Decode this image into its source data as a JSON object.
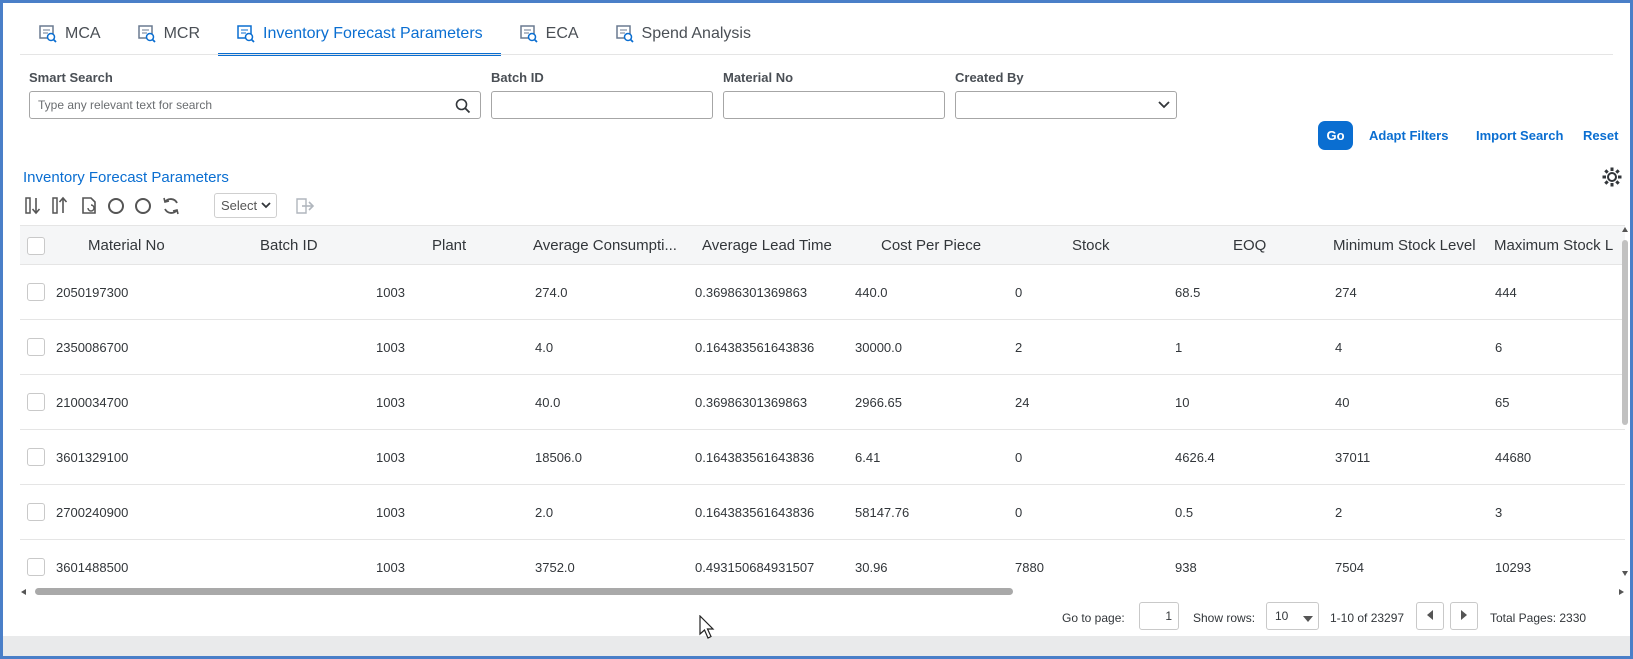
{
  "tabs": [
    {
      "label": "MCA",
      "icon": "report-icon",
      "active": false
    },
    {
      "label": "MCR",
      "icon": "report-icon",
      "active": false
    },
    {
      "label": "Inventory Forecast Parameters",
      "icon": "report-icon",
      "active": true
    },
    {
      "label": "ECA",
      "icon": "report-icon",
      "active": false
    },
    {
      "label": "Spend Analysis",
      "icon": "report-icon",
      "active": false
    }
  ],
  "filters": {
    "smart_search_label": "Smart Search",
    "smart_search_placeholder": "Type any relevant text for search",
    "batch_id_label": "Batch ID",
    "batch_id_value": "",
    "material_no_label": "Material No",
    "material_no_value": "",
    "created_by_label": "Created By",
    "created_by_value": ""
  },
  "actions": {
    "go": "Go",
    "adapt_filters": "Adapt Filters",
    "import_search": "Import Search",
    "reset": "Reset"
  },
  "table": {
    "title": "Inventory Forecast Parameters",
    "toolbar_select": "Select",
    "columns": [
      "Material No",
      "Batch ID",
      "Plant",
      "Average Consumpti...",
      "Average Lead Time",
      "Cost Per Piece",
      "Stock",
      "EOQ",
      "Minimum Stock Level",
      "Maximum Stock L"
    ],
    "rows": [
      [
        "2050197300",
        "",
        "1003",
        "274.0",
        "0.36986301369863",
        "440.0",
        "0",
        "68.5",
        "274",
        "444"
      ],
      [
        "2350086700",
        "",
        "1003",
        "4.0",
        "0.164383561643836",
        "30000.0",
        "2",
        "1",
        "4",
        "6"
      ],
      [
        "2100034700",
        "",
        "1003",
        "40.0",
        "0.36986301369863",
        "2966.65",
        "24",
        "10",
        "40",
        "65"
      ],
      [
        "3601329100",
        "",
        "1003",
        "18506.0",
        "0.164383561643836",
        "6.41",
        "0",
        "4626.4",
        "37011",
        "44680"
      ],
      [
        "2700240900",
        "",
        "1003",
        "2.0",
        "0.164383561643836",
        "58147.76",
        "0",
        "0.5",
        "2",
        "3"
      ],
      [
        "3601488500",
        "",
        "1003",
        "3752.0",
        "0.493150684931507",
        "30.96",
        "7880",
        "938",
        "7504",
        "10293"
      ]
    ]
  },
  "pagination": {
    "go_to_page_label": "Go to page:",
    "page_value": "1",
    "show_rows_label": "Show rows:",
    "rows_value": "10",
    "range": "1-10 of 23297",
    "total_pages": "Total Pages: 2330"
  },
  "colors": {
    "accent": "#0a6ed1",
    "frame": "#4a7fc8"
  }
}
